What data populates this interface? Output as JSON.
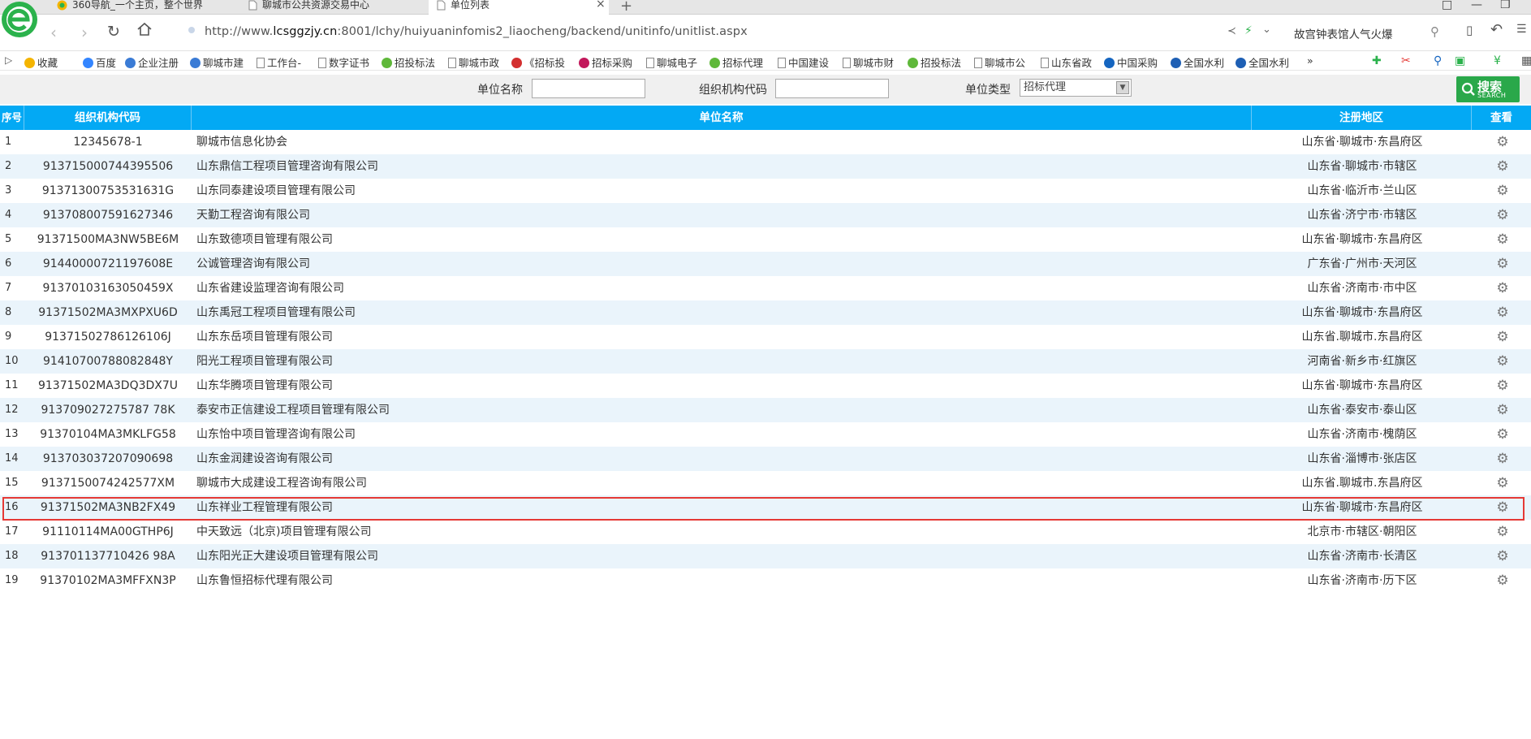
{
  "browser": {
    "tabs": [
      {
        "label": "360导航_一个主页，整个世界"
      },
      {
        "label": "聊城市公共资源交易中心"
      },
      {
        "label": "单位列表"
      }
    ],
    "tab_close": "×",
    "new_tab": "+",
    "url_prefix": "http://www.",
    "url_domain": "lcsggzjy.cn",
    "url_rest": ":8001/lchy/huiyuaninfomis2_liaocheng/backend/unitinfo/unitlist.aspx",
    "search_text": "故宫钟表馆人气火爆"
  },
  "bookmarks": [
    {
      "label": "收藏",
      "icon": "star-icon"
    },
    {
      "label": "百度",
      "icon": "baidu-icon"
    },
    {
      "label": "企业注册",
      "icon": "globe-icon"
    },
    {
      "label": "聊城市建",
      "icon": "globe-icon"
    },
    {
      "label": "工作台-",
      "icon": "page-icon"
    },
    {
      "label": "数字证书",
      "icon": "page-icon"
    },
    {
      "label": "招投标法",
      "icon": "green-icon"
    },
    {
      "label": "聊城市政",
      "icon": "page-icon"
    },
    {
      "label": "《招标投",
      "icon": "red-icon"
    },
    {
      "label": "招标采购",
      "icon": "pink-icon"
    },
    {
      "label": "聊城电子",
      "icon": "page-icon"
    },
    {
      "label": "招标代理",
      "icon": "green-icon"
    },
    {
      "label": "中国建设",
      "icon": "page-icon"
    },
    {
      "label": "聊城市财",
      "icon": "page-icon"
    },
    {
      "label": "招投标法",
      "icon": "green-icon"
    },
    {
      "label": "聊城市公",
      "icon": "page-icon"
    },
    {
      "label": "山东省政",
      "icon": "page-icon"
    },
    {
      "label": "中国采购",
      "icon": "flag-icon"
    },
    {
      "label": "全国水利",
      "icon": "wave-icon"
    },
    {
      "label": "全国水利",
      "icon": "wave-icon"
    }
  ],
  "bookmark_more": "»",
  "filter": {
    "unit_name_label": "单位名称",
    "unit_name_value": "",
    "org_code_label": "组织机构代码",
    "org_code_value": "",
    "unit_type_label": "单位类型",
    "unit_type_value": "招标代理",
    "search_label": "搜索",
    "search_sub": "SEARCH"
  },
  "table": {
    "headers": {
      "idx": "序号",
      "code": "组织机构代码",
      "name": "单位名称",
      "area": "注册地区",
      "view": "查看"
    },
    "rows": [
      {
        "idx": "1",
        "code": "12345678-1",
        "name": "聊城市信息化协会",
        "area": "山东省·聊城市·东昌府区"
      },
      {
        "idx": "2",
        "code": "913715000744395506",
        "name": "山东鼎信工程项目管理咨询有限公司",
        "area": "山东省·聊城市·市辖区"
      },
      {
        "idx": "3",
        "code": "91371300753531631G",
        "name": "山东同泰建设项目管理有限公司",
        "area": "山东省·临沂市·兰山区"
      },
      {
        "idx": "4",
        "code": "913708007591627346",
        "name": "天勤工程咨询有限公司",
        "area": "山东省·济宁市·市辖区"
      },
      {
        "idx": "5",
        "code": "91371500MA3NW5BE6M",
        "name": "山东致德项目管理有限公司",
        "area": "山东省·聊城市·东昌府区"
      },
      {
        "idx": "6",
        "code": "91440000721197608E",
        "name": "公诚管理咨询有限公司",
        "area": "广东省·广州市·天河区"
      },
      {
        "idx": "7",
        "code": "91370103163050459X",
        "name": "山东省建设监理咨询有限公司",
        "area": "山东省·济南市·市中区"
      },
      {
        "idx": "8",
        "code": "91371502MA3MXPXU6D",
        "name": "山东禹冠工程项目管理有限公司",
        "area": "山东省·聊城市·东昌府区"
      },
      {
        "idx": "9",
        "code": "91371502786126106J",
        "name": "山东东岳项目管理有限公司",
        "area": "山东省.聊城市.东昌府区"
      },
      {
        "idx": "10",
        "code": "91410700788082848Y",
        "name": "阳光工程项目管理有限公司",
        "area": "河南省·新乡市·红旗区"
      },
      {
        "idx": "11",
        "code": "91371502MA3DQ3DX7U",
        "name": "山东华腾项目管理有限公司",
        "area": "山东省·聊城市·东昌府区"
      },
      {
        "idx": "12",
        "code": "913709027275787 78K",
        "name": "泰安市正信建设工程项目管理有限公司",
        "area": "山东省·泰安市·泰山区"
      },
      {
        "idx": "13",
        "code": "91370104MA3MKLFG58",
        "name": "山东怡中项目管理咨询有限公司",
        "area": "山东省·济南市·槐荫区"
      },
      {
        "idx": "14",
        "code": "913703037207090698",
        "name": "山东金润建设咨询有限公司",
        "area": "山东省·淄博市·张店区"
      },
      {
        "idx": "15",
        "code": "9137150074242577XM",
        "name": "聊城市大成建设工程咨询有限公司",
        "area": "山东省.聊城市.东昌府区"
      },
      {
        "idx": "16",
        "code": "91371502MA3NB2FX49",
        "name": "山东祥业工程管理有限公司",
        "area": "山东省·聊城市·东昌府区"
      },
      {
        "idx": "17",
        "code": "91110114MA00GTHP6J",
        "name": "中天致远（北京)项目管理有限公司",
        "area": "北京市·市辖区·朝阳区"
      },
      {
        "idx": "18",
        "code": "913701137710426 98A",
        "name": "山东阳光正大建设项目管理有限公司",
        "area": "山东省·济南市·长清区"
      },
      {
        "idx": "19",
        "code": "91370102MA3MFFXN3P",
        "name": "山东鲁恒招标代理有限公司",
        "area": "山东省·济南市·历下区"
      }
    ]
  },
  "colors": {
    "header_bg": "#03a9f4",
    "alt_row": "#eaf4fb",
    "search_btn": "#2aa84a",
    "highlight": "#e53935"
  }
}
